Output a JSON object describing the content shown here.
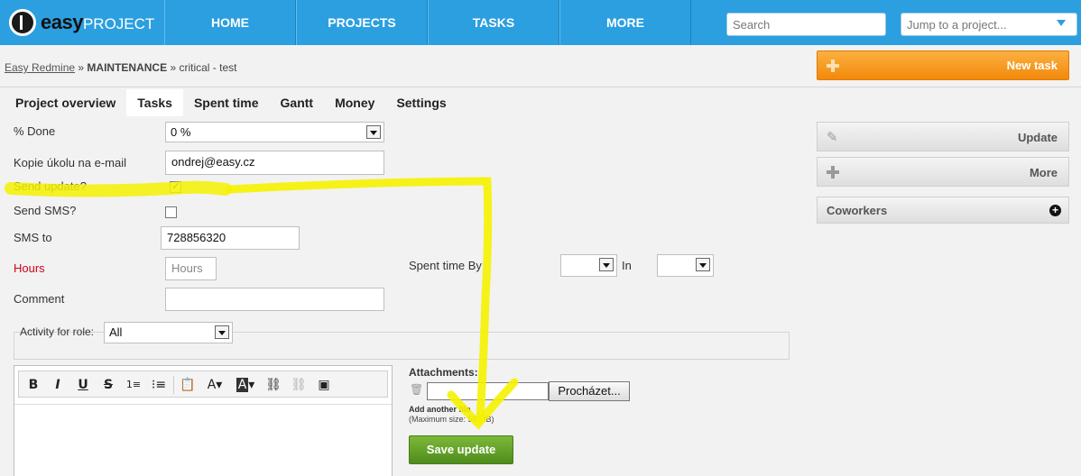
{
  "header": {
    "logo_bold": "easy",
    "logo_light": "PROJECT",
    "nav": [
      "HOME",
      "PROJECTS",
      "TASKS",
      "MORE"
    ],
    "search_placeholder": "Search",
    "jump_placeholder": "Jump to a project..."
  },
  "breadcrumb": {
    "root": "Easy Redmine",
    "sep1": "»",
    "project": "MAINTENANCE",
    "sep2": "»",
    "issue": "critical - test"
  },
  "new_task_label": "New task",
  "tabs": [
    "Project overview",
    "Tasks",
    "Spent time",
    "Gantt",
    "Money",
    "Settings"
  ],
  "form": {
    "done_label": "% Done",
    "done_value": "0 %",
    "copy_label": "Kopie úkolu na e-mail",
    "copy_value": "ondrej@easy.cz",
    "send_update_label": "Send update?",
    "send_update_checked": true,
    "send_sms_label": "Send SMS?",
    "send_sms_checked": false,
    "sms_to_label": "SMS to",
    "sms_to_value": "728856320",
    "hours_label": "Hours",
    "hours_placeholder": "Hours",
    "spent_time_by_label": "Spent time By",
    "in_label": "In",
    "comment_label": "Comment",
    "activity_label": "Activity for role:",
    "activity_value": "All"
  },
  "editor_toolbar": [
    "B",
    "I",
    "U",
    "S",
    "ordered-list",
    "bullet-list",
    "paste",
    "text-color",
    "bg-color",
    "link",
    "unlink",
    "image"
  ],
  "attachments": {
    "title": "Attachments:",
    "browse_label": "Procházet...",
    "add_another": "Add another file",
    "max_size": "(Maximum size: 50 MB)"
  },
  "save_label": "Save update",
  "sidebar": {
    "update_label": "Update",
    "more_label": "More",
    "coworkers_label": "Coworkers"
  },
  "colors": {
    "header_blue": "#2b9fe0",
    "new_task_orange": "#f2890b",
    "save_green": "#5c9e24",
    "highlight_yellow": "#f5f200"
  }
}
